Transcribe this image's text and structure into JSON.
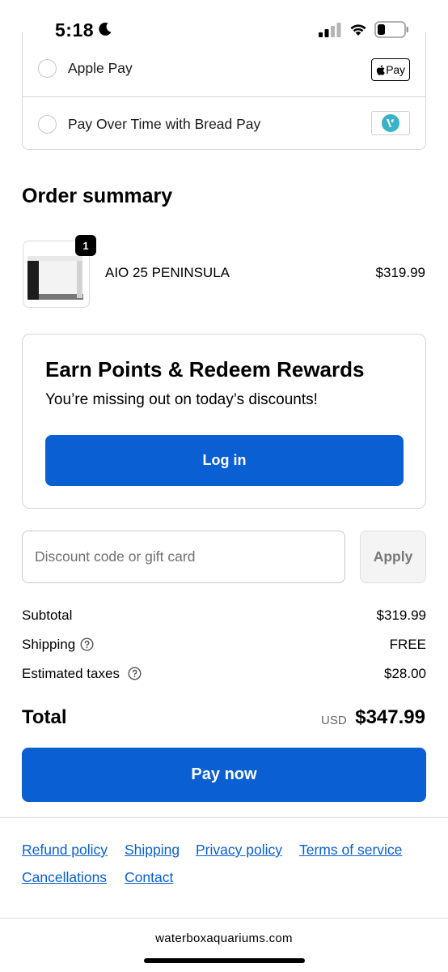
{
  "status_bar": {
    "time": "5:18",
    "icons": [
      "moon-icon",
      "cellular-signal-icon",
      "wifi-icon",
      "battery-icon"
    ]
  },
  "payment_methods": {
    "options": [
      {
        "label": "Apple Pay",
        "logo_text": "Pay",
        "logo_icon": "apple-icon"
      },
      {
        "label": "Pay Over Time with Bread Pay",
        "logo_icon": "bread-pay-logo"
      }
    ]
  },
  "order_summary": {
    "title": "Order summary",
    "item": {
      "quantity_badge": "1",
      "name": "AIO 25 PENINSULA",
      "price": "$319.99"
    }
  },
  "rewards": {
    "title": "Earn Points & Redeem Rewards",
    "subtitle": "You’re missing out on today’s discounts!",
    "login_label": "Log in"
  },
  "discount": {
    "placeholder": "Discount code or gift card",
    "value": "",
    "apply_label": "Apply"
  },
  "totals": {
    "subtotal_label": "Subtotal",
    "subtotal_value": "$319.99",
    "shipping_label": "Shipping",
    "shipping_value": "FREE",
    "taxes_label": "Estimated taxes",
    "taxes_value": "$28.00",
    "total_label": "Total",
    "total_currency": "USD",
    "total_value": "$347.99"
  },
  "pay_now_label": "Pay now",
  "footer": {
    "links": [
      "Refund policy",
      "Shipping",
      "Privacy policy",
      "Terms of service",
      "Cancellations",
      "Contact"
    ]
  },
  "browser": {
    "domain": "waterboxaquariums.com"
  },
  "colors": {
    "accent": "#0a5fd3",
    "border": "#d9d9d9"
  }
}
